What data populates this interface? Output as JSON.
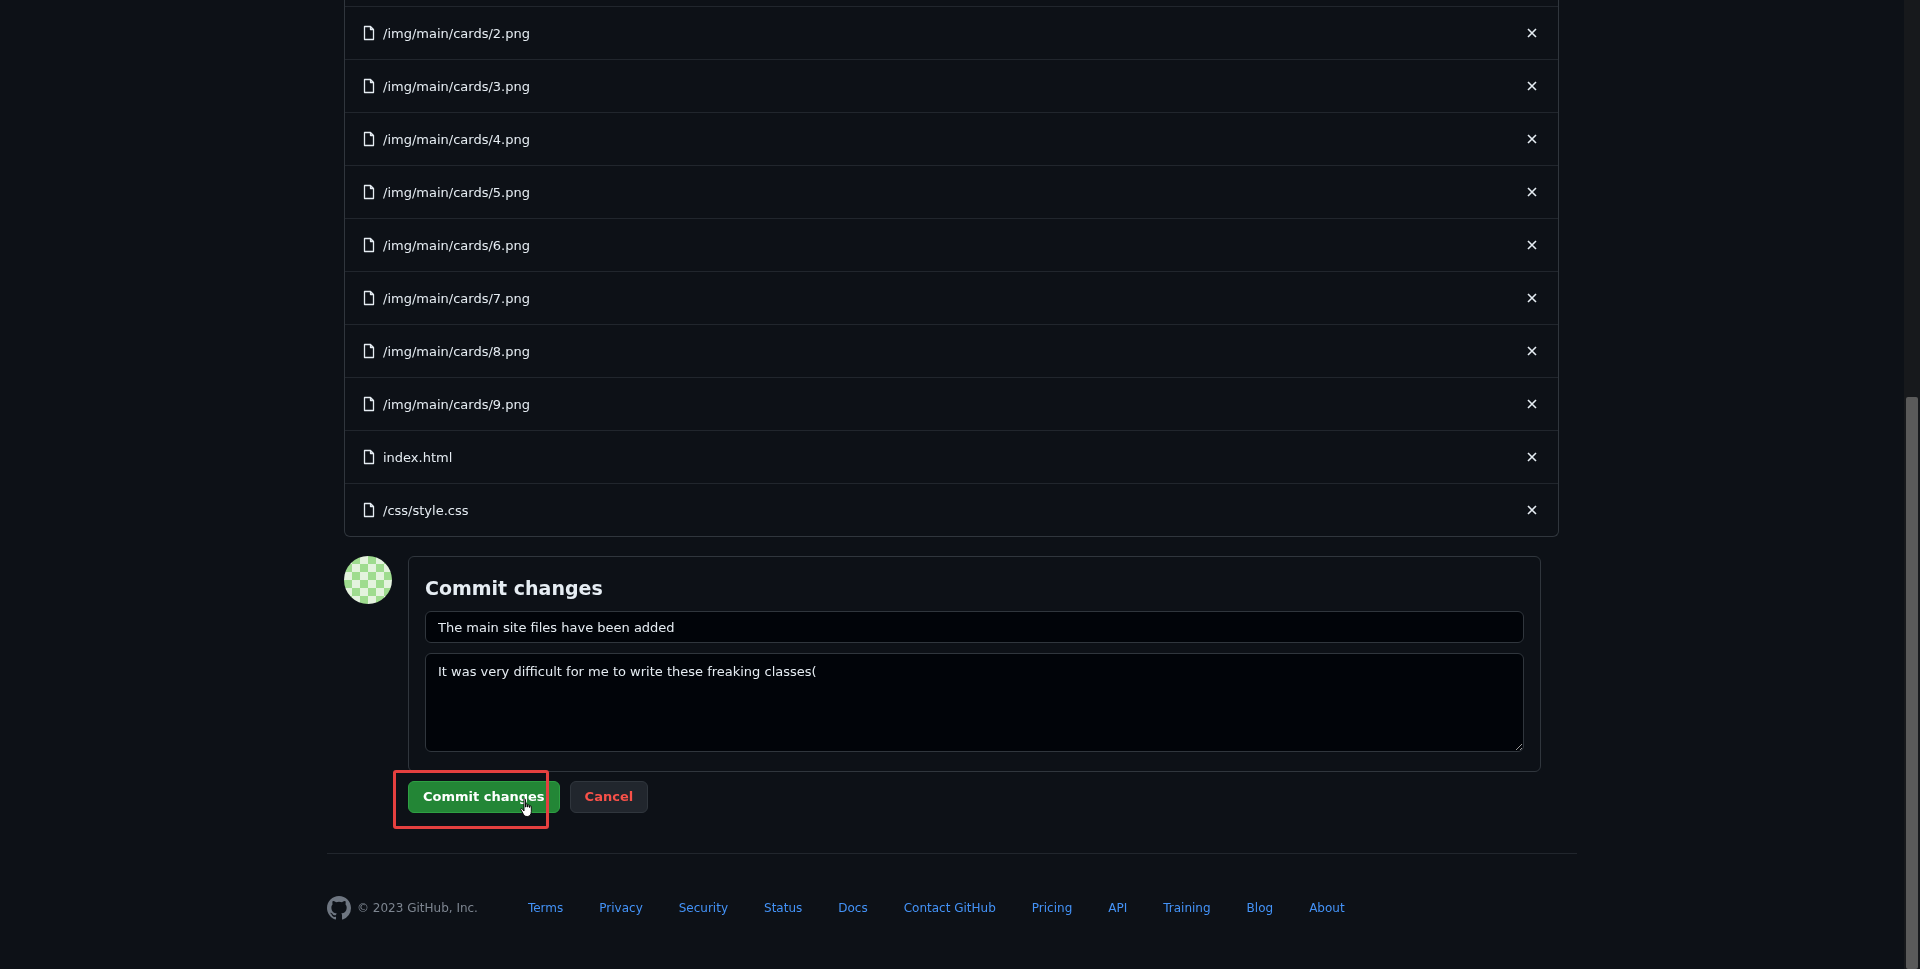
{
  "files": [
    {
      "path": "/img/main/cards/2.png"
    },
    {
      "path": "/img/main/cards/3.png"
    },
    {
      "path": "/img/main/cards/4.png"
    },
    {
      "path": "/img/main/cards/5.png"
    },
    {
      "path": "/img/main/cards/6.png"
    },
    {
      "path": "/img/main/cards/7.png"
    },
    {
      "path": "/img/main/cards/8.png"
    },
    {
      "path": "/img/main/cards/9.png"
    },
    {
      "path": "index.html"
    },
    {
      "path": "/css/style.css"
    }
  ],
  "commit": {
    "title": "Commit changes",
    "summary": "The main site files have been added",
    "description": "It was very difficult for me to write these freaking classes("
  },
  "actions": {
    "commit": "Commit changes",
    "cancel": "Cancel",
    "highlighted": true
  },
  "footer": {
    "copyright": "© 2023 GitHub, Inc.",
    "links": [
      "Terms",
      "Privacy",
      "Security",
      "Status",
      "Docs",
      "Contact GitHub",
      "Pricing",
      "API",
      "Training",
      "Blog",
      "About"
    ]
  }
}
